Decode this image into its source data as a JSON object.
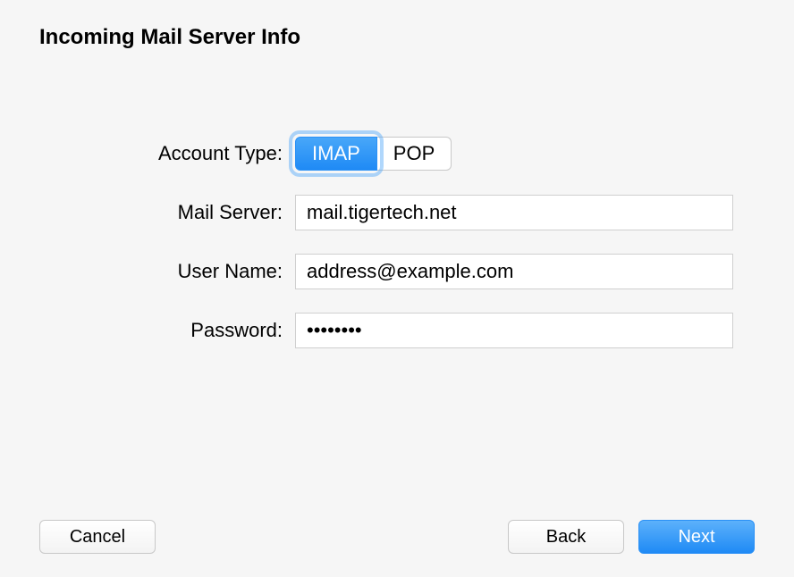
{
  "title": "Incoming Mail Server Info",
  "form": {
    "account_type": {
      "label": "Account Type:",
      "options": [
        "IMAP",
        "POP"
      ],
      "selected": "IMAP"
    },
    "mail_server": {
      "label": "Mail Server:",
      "value": "mail.tigertech.net"
    },
    "user_name": {
      "label": "User Name:",
      "value": "address@example.com"
    },
    "password": {
      "label": "Password:",
      "value": "••••••••"
    }
  },
  "buttons": {
    "cancel": "Cancel",
    "back": "Back",
    "next": "Next"
  }
}
